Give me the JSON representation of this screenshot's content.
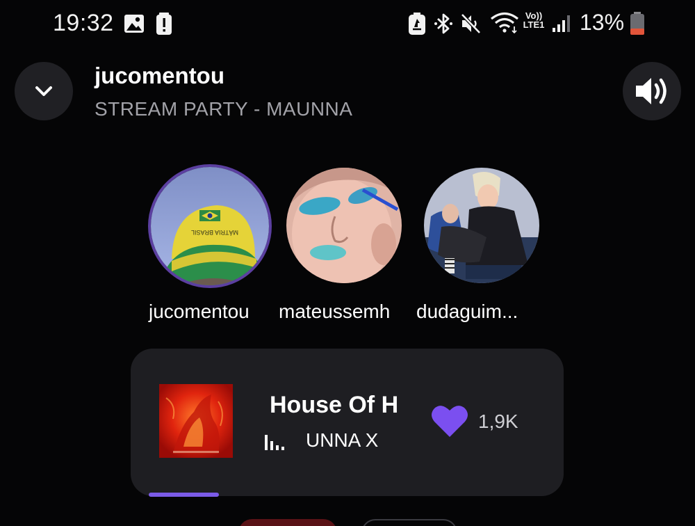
{
  "status_bar": {
    "time": "19:32",
    "network_label_top": "Vo))",
    "network_label_bottom": "LTE1",
    "battery_percent": "13%",
    "icons": [
      "gallery-icon",
      "alert-icon",
      "battery-saver-icon",
      "bluetooth-icon",
      "mute-icon",
      "wifi-icon",
      "signal-icon",
      "battery-icon"
    ]
  },
  "header": {
    "host": "jucomentou",
    "party_title": "STREAM PARTY - MAUNNA",
    "collapse_icon": "chevron-down-icon",
    "volume_icon": "volume-icon"
  },
  "participants": [
    {
      "name": "jucomentou"
    },
    {
      "name": "mateussemh"
    },
    {
      "name": "dudaguim..."
    }
  ],
  "now_playing": {
    "title": "House Of H",
    "artist": "UNNA X",
    "likes": "1,9K",
    "progress_percent": 18,
    "colors": {
      "accent": "#7b5be8",
      "heart": "#7b4ff0"
    }
  }
}
